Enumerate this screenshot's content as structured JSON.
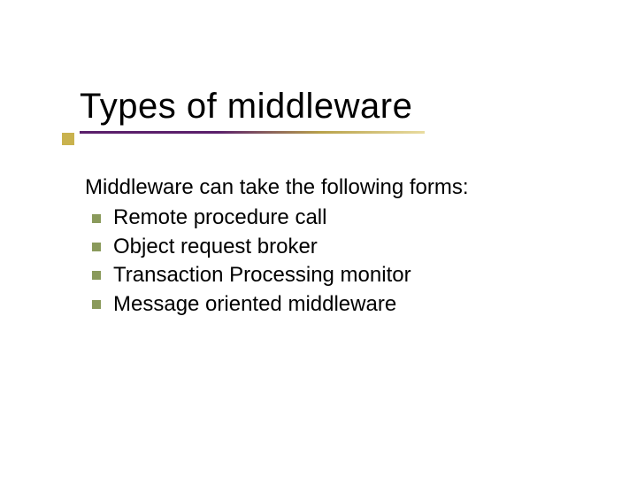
{
  "slide": {
    "title": "Types of middleware",
    "intro": "Middleware can take the following forms:",
    "items": [
      "Remote procedure call",
      "Object request broker",
      "Transaction Processing monitor",
      "Message oriented middleware"
    ]
  }
}
